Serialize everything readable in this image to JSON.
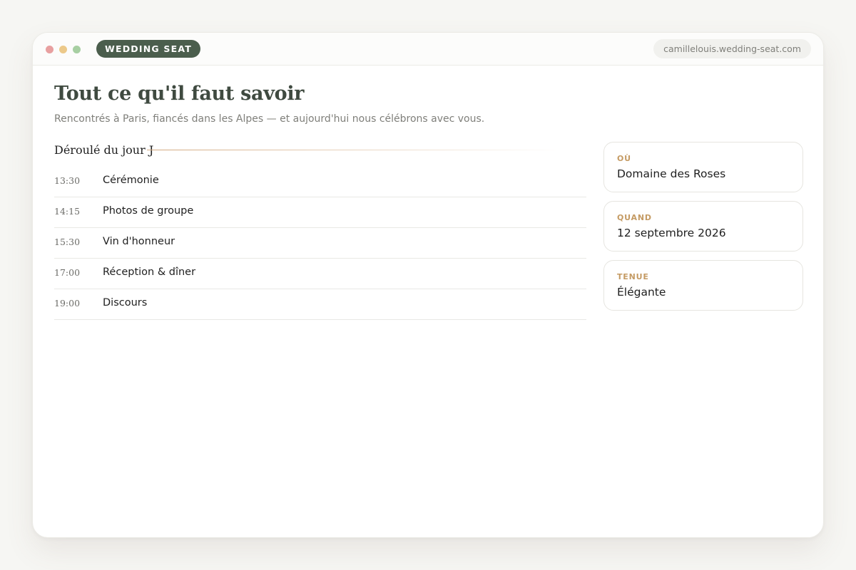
{
  "colors": {
    "brand_bg": "#4b5e4d",
    "accent_gold": "#c59b64",
    "dot_red": "#e8a0a0",
    "dot_yellow": "#ecc98a",
    "dot_green": "#a7cfa2"
  },
  "titlebar": {
    "brand": "WEDDING SEAT",
    "url": "camillelouis.wedding-seat.com"
  },
  "main": {
    "title": "Tout ce qu'il faut savoir",
    "subtitle": "Rencontrés à Paris, fiancés dans les Alpes — et aujourd'hui nous célébrons avec vous.",
    "schedule": {
      "title": "Déroulé du jour J",
      "items": [
        {
          "time": "13:30",
          "event": "Cérémonie"
        },
        {
          "time": "14:15",
          "event": "Photos de groupe"
        },
        {
          "time": "15:30",
          "event": "Vin d'honneur"
        },
        {
          "time": "17:00",
          "event": "Réception & dîner"
        },
        {
          "time": "19:00",
          "event": "Discours"
        }
      ]
    },
    "info": [
      {
        "label": "OÙ",
        "value": "Domaine des Roses"
      },
      {
        "label": "QUAND",
        "value": "12 septembre 2026"
      },
      {
        "label": "TENUE",
        "value": "Élégante"
      }
    ]
  }
}
